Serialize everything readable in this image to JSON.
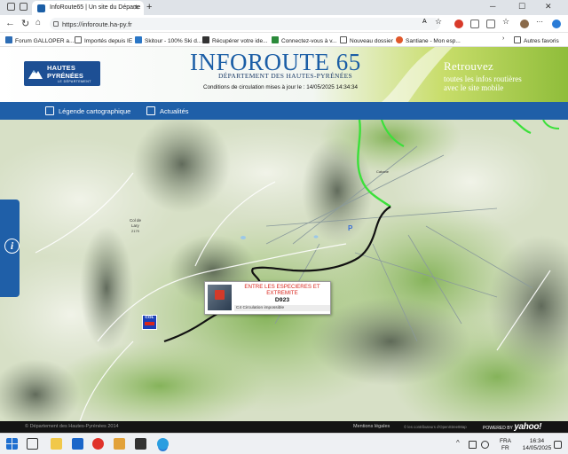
{
  "browser": {
    "tab_title": "InfoRoute65 | Un site du Départe",
    "tab_close": "✕",
    "new_tab": "+",
    "url": "https://inforoute.ha-py.fr",
    "window_controls": {
      "minimize": "─",
      "maximize": "☐",
      "close": "✕"
    }
  },
  "favorites": [
    {
      "label": "Forum GALLOPER a...",
      "icon": "forum-icon",
      "color": "#2d6db5"
    },
    {
      "label": "Importés depuis IE",
      "icon": "folder-icon",
      "color": "#555555"
    },
    {
      "label": "Skitour - 100% Ski d...",
      "icon": "skitour-icon",
      "color": "#2a76c6"
    },
    {
      "label": "Récupérer votre ide...",
      "icon": "key-icon",
      "color": "#333333"
    },
    {
      "label": "Connectez-vous à v...",
      "icon": "login-icon",
      "color": "#2a8a3a"
    },
    {
      "label": "Nouveau dossier",
      "icon": "folder-icon",
      "color": "#555555"
    },
    {
      "label": "Santiane - Mon esp...",
      "icon": "santiane-icon",
      "color": "#e0572a"
    },
    {
      "label": "Autres favoris",
      "icon": "folder-icon",
      "color": "#555555"
    }
  ],
  "header": {
    "logo_line1": "HAUTES",
    "logo_line2": "PYRÉNÉES",
    "logo_line3": "LE DÉPARTEMENT",
    "title": "INFOROUTE 65",
    "subtitle": "DÉPARTEMENT DES HAUTES-PYRÉNÉES",
    "conditions": "Conditions de circulation mises à jour le :  14/05/2025 14:34:34",
    "promo_line1": "Retrouvez",
    "promo_line2": "toutes les infos routières",
    "promo_line3": "avec le site mobile"
  },
  "nav": [
    {
      "label": "Légende cartographique",
      "icon": "book-icon"
    },
    {
      "label": "Actualités",
      "icon": "calendar-icon"
    }
  ],
  "map": {
    "info_button": "i",
    "col_marker_label": "COL",
    "popup": {
      "title": "ENTRE LES ESPECIERES ET EXTREMITE",
      "road": "D923",
      "status": "C4 Circulation impossible"
    },
    "colors": {
      "closed_road": "#111111",
      "open_road": "#3be03a"
    }
  },
  "footer": {
    "copyright": "© Département des Hautes-Pyrénées 2014",
    "legal": "Mentions légales",
    "osm": "© les contributeurs d'OpenStreetMap",
    "powered": "POWERED BY",
    "yahoo": "yahoo!"
  },
  "taskbar": {
    "lang1": "FRA",
    "lang2": "FR",
    "time": "16:34",
    "date": "14/05/2025"
  }
}
